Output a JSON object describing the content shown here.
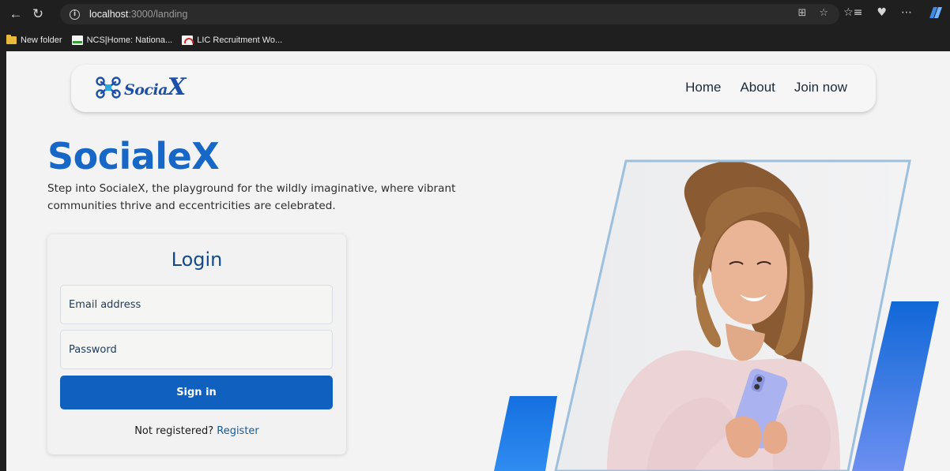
{
  "browser": {
    "url_host": "localhost",
    "url_path": ":3000/landing",
    "bookmarks": [
      {
        "label": "New folder",
        "icon": "folder-icon"
      },
      {
        "label": "NCS|Home: Nationa...",
        "icon": "ncs-favicon"
      },
      {
        "label": "LIC Recruitment Wo...",
        "icon": "lic-favicon"
      }
    ]
  },
  "navbar": {
    "logo_text": "Socia",
    "logo_x": "X",
    "links": [
      "Home",
      "About",
      "Join now"
    ]
  },
  "hero": {
    "title": "SocialeX",
    "description": "Step into SocialeX, the playground for the wildly imaginative, where vibrant communities thrive and eccentricities are celebrated."
  },
  "login": {
    "title": "Login",
    "email_placeholder": "Email address",
    "password_placeholder": "Password",
    "submit_label": "Sign in",
    "register_prompt": "Not registered?",
    "register_link": "Register"
  },
  "colors": {
    "brand": "#1767c7",
    "button": "#1060c0",
    "accent_stripe": "#1a73e8"
  }
}
